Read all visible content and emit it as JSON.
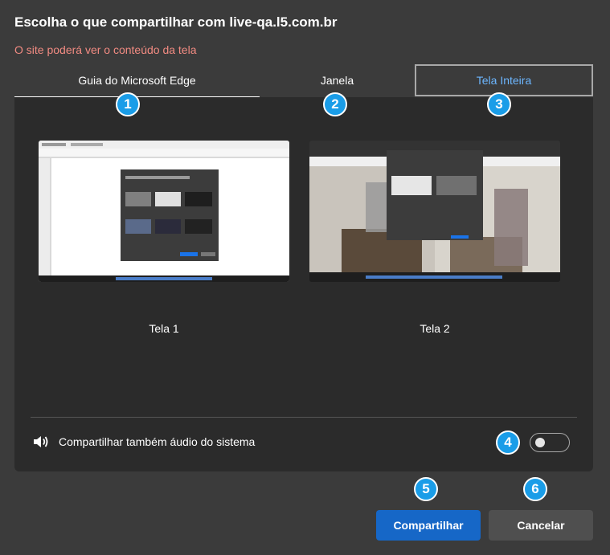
{
  "dialog": {
    "title": "Escolha o que compartilhar com live-qa.l5.com.br",
    "subtitle": "O site poderá ver o conteúdo da tela"
  },
  "tabs": [
    {
      "label": "Guia do Microsoft Edge",
      "selected": false
    },
    {
      "label": "Janela",
      "selected": false
    },
    {
      "label": "Tela Inteira",
      "selected": true
    }
  ],
  "screens": [
    {
      "label": "Tela 1"
    },
    {
      "label": "Tela 2"
    }
  ],
  "audio": {
    "label": "Compartilhar também áudio do sistema",
    "enabled": false,
    "icon": "speaker-icon"
  },
  "buttons": {
    "share": "Compartilhar",
    "cancel": "Cancelar"
  },
  "badges": [
    "1",
    "2",
    "3",
    "4",
    "5",
    "6"
  ],
  "colors": {
    "accent": "#1667c7",
    "badge": "#1a9de8",
    "warning_text": "#f28b82",
    "selected_tab_text": "#6cb6ff"
  }
}
